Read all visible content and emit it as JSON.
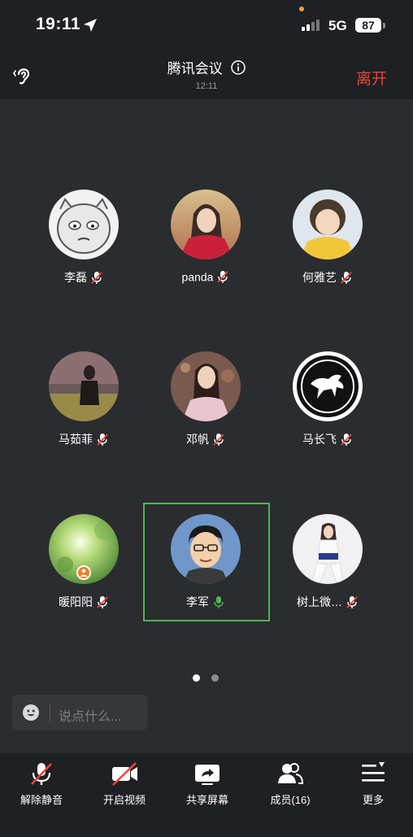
{
  "status_bar": {
    "time": "19:11",
    "network": "5G",
    "battery": "87"
  },
  "header": {
    "title": "腾讯会议",
    "duration": "12:11",
    "leave_label": "离开"
  },
  "participants": [
    {
      "name": "李磊",
      "mic": "muted"
    },
    {
      "name": "panda",
      "mic": "muted"
    },
    {
      "name": "何雅艺",
      "mic": "muted"
    },
    {
      "name": "马茹菲",
      "mic": "muted"
    },
    {
      "name": "邓帆",
      "mic": "muted"
    },
    {
      "name": "马长飞",
      "mic": "muted"
    },
    {
      "name": "暖阳阳",
      "mic": "muted"
    },
    {
      "name": "李军",
      "mic": "speaking"
    },
    {
      "name": "树上微…",
      "mic": "muted"
    }
  ],
  "pagination": {
    "current": 1,
    "total": 2
  },
  "chat": {
    "placeholder": "说点什么..."
  },
  "toolbar": {
    "unmute": "解除静音",
    "start_video": "开启视频",
    "share_screen": "共享屏幕",
    "members": "成员(16)",
    "more": "更多"
  },
  "colors": {
    "leave": "#e8453c",
    "active_speaker": "#4fb554",
    "muted_slash": "#e8453c"
  }
}
